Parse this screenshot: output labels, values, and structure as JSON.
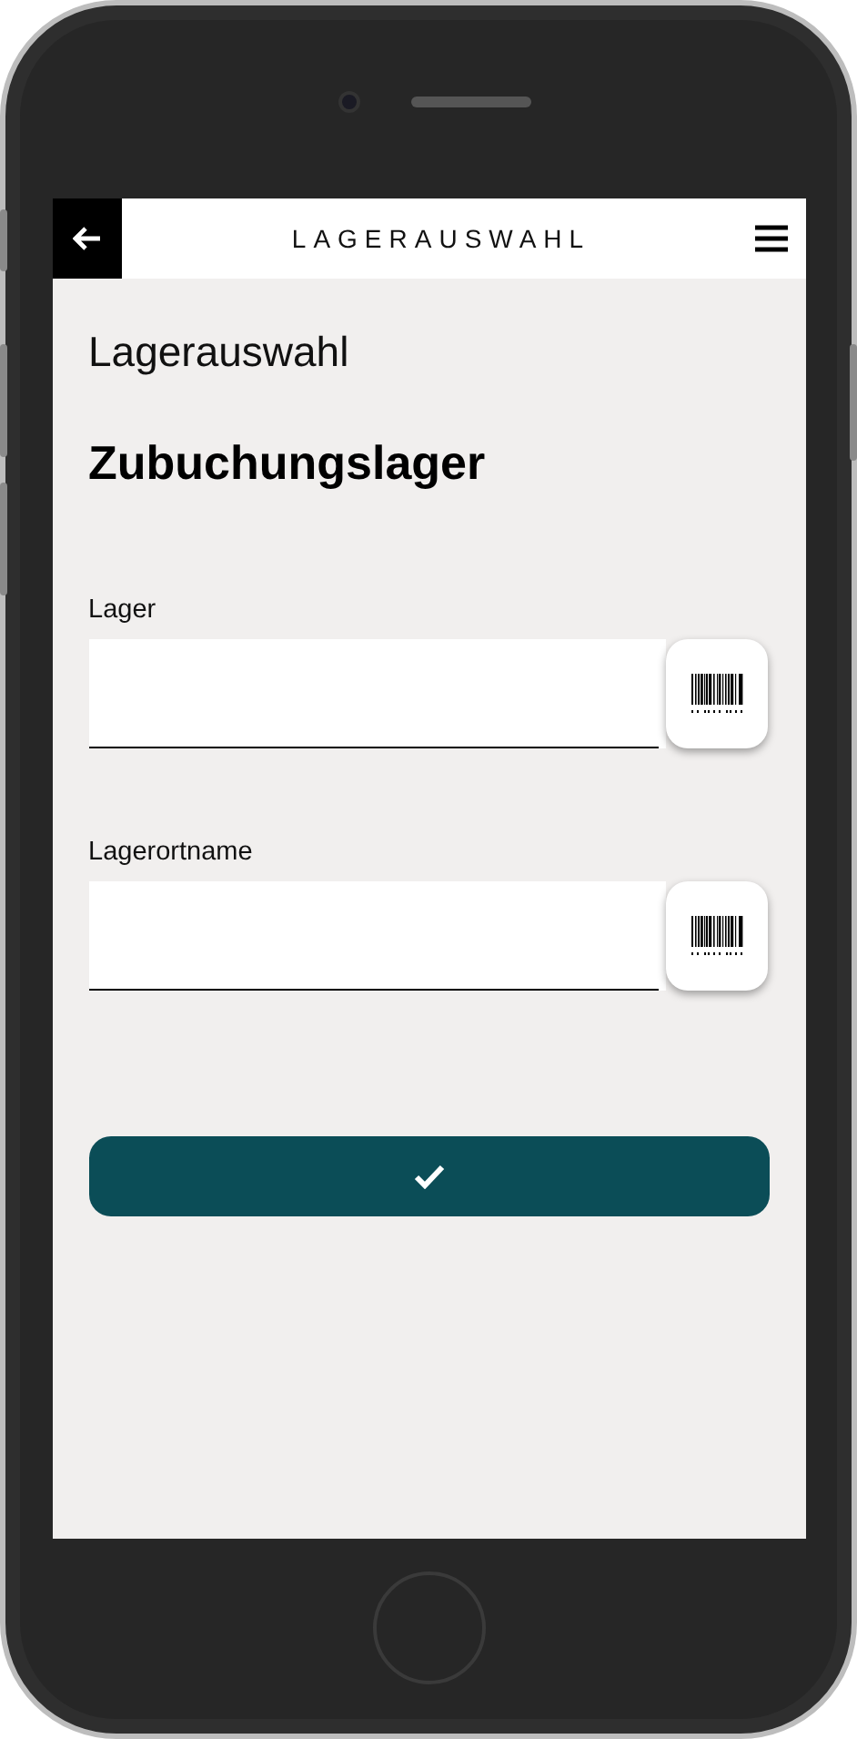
{
  "header": {
    "title": "LAGERAUSWAHL"
  },
  "page_title": "Lagerauswahl",
  "heading": "Zubuchungslager",
  "fields": [
    {
      "label": "Lager"
    },
    {
      "label": "Lagerortname"
    }
  ]
}
